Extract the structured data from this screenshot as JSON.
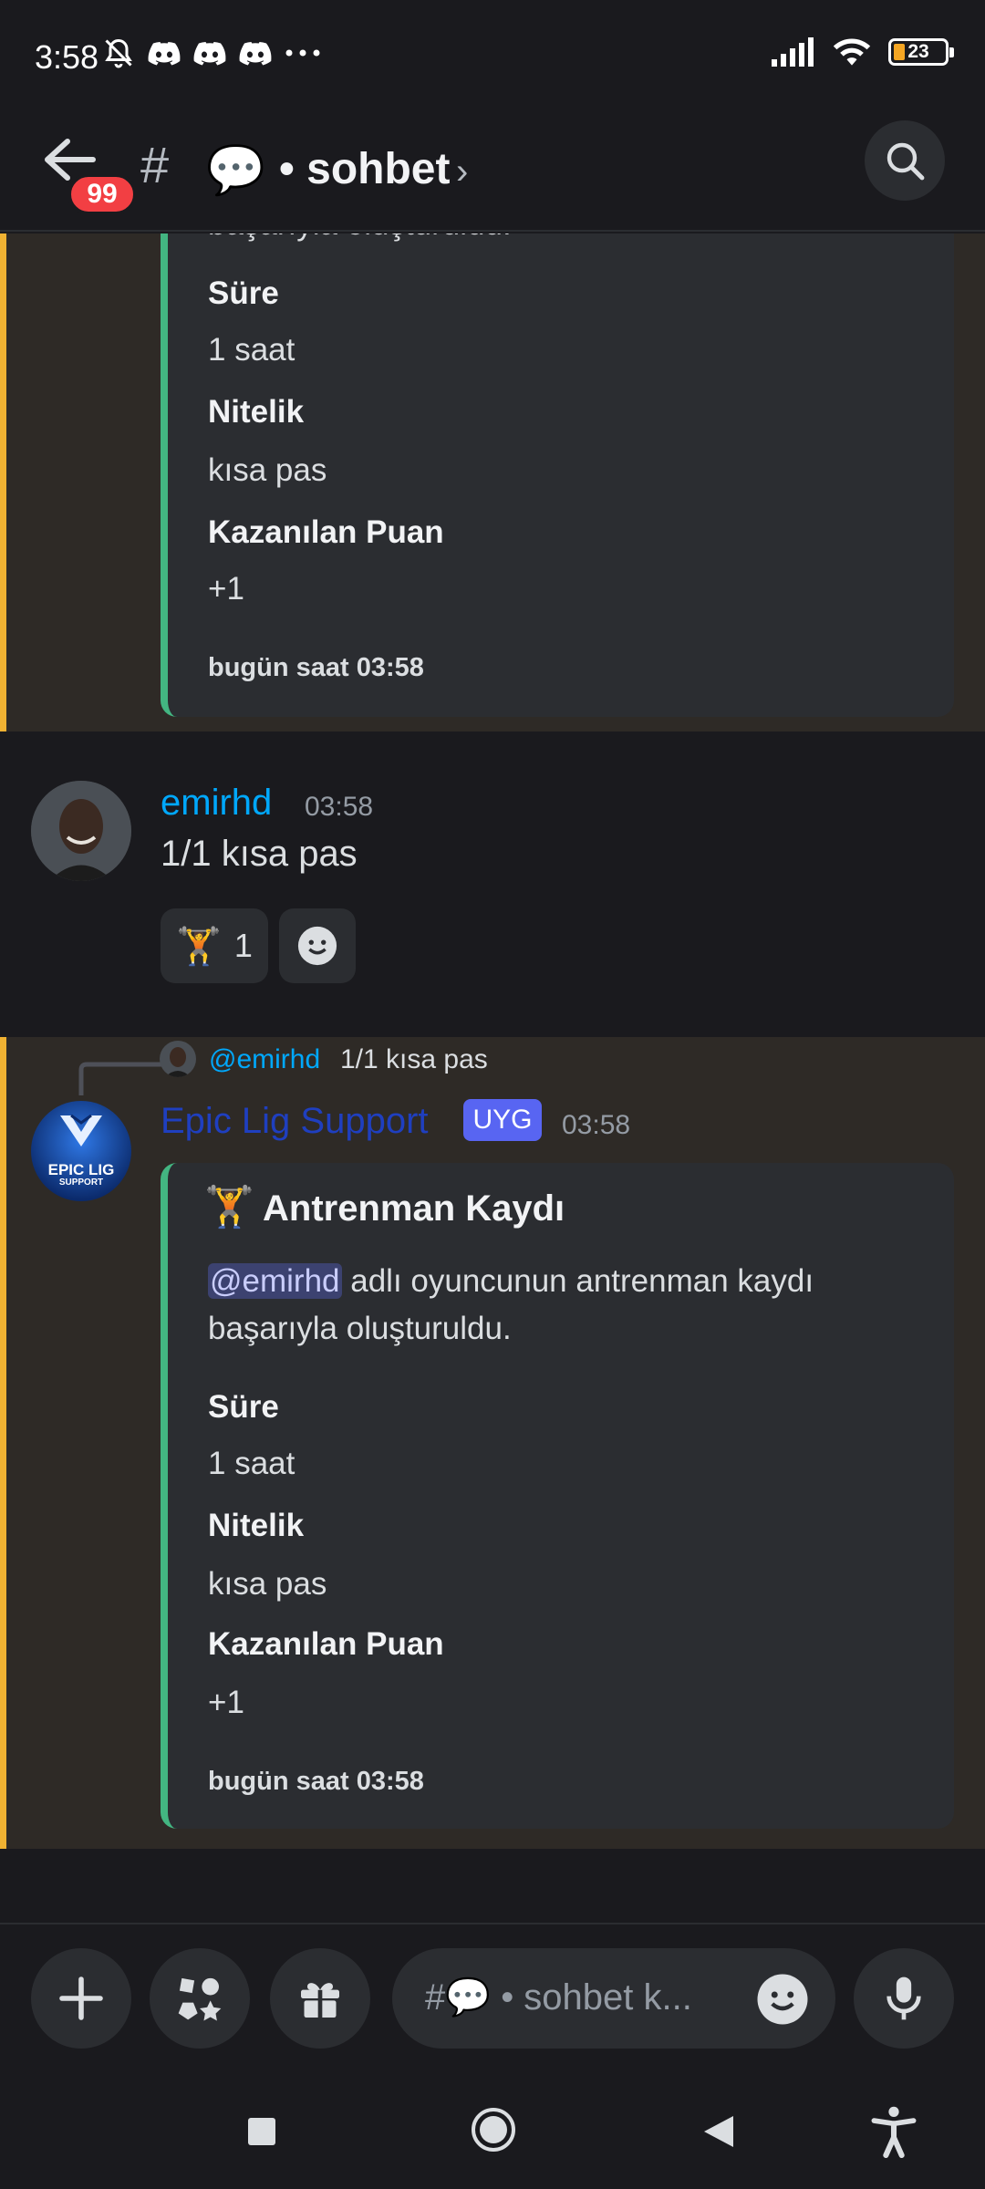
{
  "status_bar": {
    "time": "3:58",
    "battery": "23"
  },
  "header": {
    "badge": "99",
    "channel_emoji": "💬",
    "channel_name": "• sohbet"
  },
  "prev_embed": {
    "partial_text": "başarıyla oluşturuldu.",
    "fields": [
      {
        "name": "Süre",
        "value": "1 saat"
      },
      {
        "name": "Nitelik",
        "value": "kısa pas"
      },
      {
        "name": "Kazanılan Puan",
        "value": "+1"
      }
    ],
    "footer": "bugün saat 03:58"
  },
  "user_message": {
    "username": "emirhd",
    "time": "03:58",
    "text": "1/1 kısa pas",
    "reaction_emoji": "🏋️",
    "reaction_count": "1"
  },
  "bot_message": {
    "reply_mention": "@emirhd",
    "reply_text": "1/1 kısa pas",
    "avatar_text_1": "EPIC LIG",
    "avatar_text_2": "SUPPORT",
    "username": "Epic Lig Support",
    "tag": "UYG",
    "time": "03:58",
    "embed": {
      "title_emoji": "🏋️",
      "title": "Antrenman Kaydı",
      "mention": "@emirhd",
      "description_1": " adlı oyuncunun antrenman kaydı",
      "description_2": "başarıyla oluşturuldu.",
      "fields": [
        {
          "name": "Süre",
          "value": "1 saat"
        },
        {
          "name": "Nitelik",
          "value": "kısa pas"
        },
        {
          "name": "Kazanılan Puan",
          "value": "+1"
        }
      ],
      "footer": "bugün saat 03:58"
    }
  },
  "input": {
    "hash": "#",
    "emoji": "💬",
    "placeholder": "• sohbet k..."
  },
  "colors": {
    "accent_blue": "#00a8fc",
    "embed_bar": "#43b581",
    "highlight_bar": "#f0b232",
    "bot_name": "#1f3fbf",
    "app_tag": "#5865f2",
    "badge": "#f23f43"
  }
}
